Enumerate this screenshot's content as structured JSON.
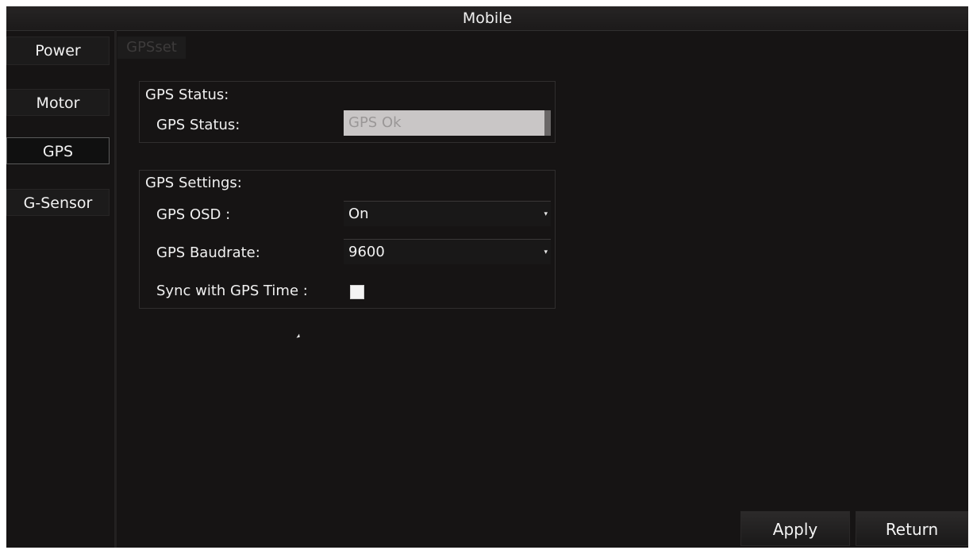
{
  "window": {
    "title": "Mobile"
  },
  "sidebar": {
    "items": [
      {
        "label": "Power"
      },
      {
        "label": "Motor"
      },
      {
        "label": "GPS"
      },
      {
        "label": "G-Sensor"
      }
    ]
  },
  "tabs": {
    "gpsset": "GPSset"
  },
  "gps_status": {
    "group_title": "GPS Status:",
    "label": "GPS Status:",
    "value": "GPS Ok"
  },
  "gps_settings": {
    "group_title": "GPS Settings:",
    "osd_label": "GPS OSD :",
    "osd_value": "On",
    "baudrate_label": "GPS Baudrate:",
    "baudrate_value": "9600",
    "sync_label": "Sync with GPS Time :"
  },
  "footer": {
    "apply": "Apply",
    "return": "Return"
  },
  "icons": {
    "dropdown": "chevron-down-icon",
    "cursor": "mouse-cursor-icon"
  }
}
